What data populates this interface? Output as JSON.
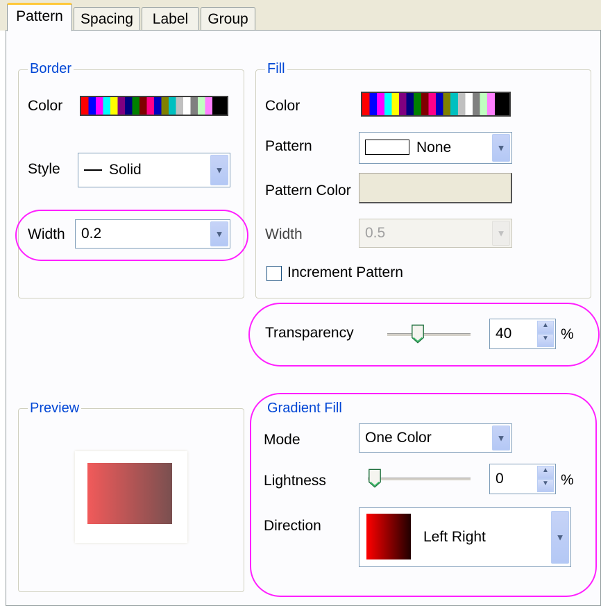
{
  "tabs": [
    "Pattern",
    "Spacing",
    "Label",
    "Group"
  ],
  "border": {
    "legend": "Border",
    "color_label": "Color",
    "style_label": "Style",
    "style_value": "Solid",
    "width_label": "Width",
    "width_value": "0.2"
  },
  "fill": {
    "legend": "Fill",
    "color_label": "Color",
    "pattern_label": "Pattern",
    "pattern_value": "None",
    "pattern_color_label": "Pattern Color",
    "width_label": "Width",
    "width_value": "0.5",
    "increment_label": "Increment Pattern",
    "increment_checked": false
  },
  "transparency": {
    "label": "Transparency",
    "value": "40",
    "unit": "%",
    "level": 0.4
  },
  "preview": {
    "legend": "Preview"
  },
  "gradient": {
    "legend": "Gradient Fill",
    "mode_label": "Mode",
    "mode_value": "One Color",
    "lightness_label": "Lightness",
    "lightness_value": "0",
    "lightness_unit": "%",
    "lightness_level": 0,
    "direction_label": "Direction",
    "direction_value": "Left Right"
  },
  "colors": {
    "highlight": "#ff20ff",
    "legend_text": "#0046d5",
    "preview_start": "#f15a5a",
    "preview_end": "#7a5050"
  }
}
